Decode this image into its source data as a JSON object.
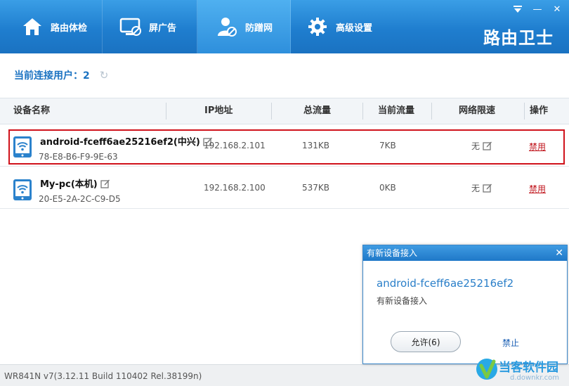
{
  "app": {
    "brand": "路由卫士",
    "status_bar": "WR841N v7(3.12.11 Build 110402 Rel.38199n)"
  },
  "nav": {
    "tabs": [
      {
        "label": "路由体检",
        "icon": "home-icon",
        "active": false
      },
      {
        "label": "屏广告",
        "icon": "monitor-block-icon",
        "active": false
      },
      {
        "label": "防蹭网",
        "icon": "user-shield-icon",
        "active": true
      },
      {
        "label": "高级设置",
        "icon": "gear-icon",
        "active": false
      }
    ]
  },
  "window_controls": {
    "menu_icon": "dropdown-icon",
    "minimize": "—",
    "close": "✕"
  },
  "users": {
    "label": "当前连接用户：2",
    "refresh_icon": "refresh-icon"
  },
  "table": {
    "headers": [
      "设备名称",
      "IP地址",
      "总流量",
      "当前流量",
      "网络限速",
      "操作"
    ],
    "rows": [
      {
        "name": "android-fceff6ae25216ef2(中兴)",
        "mac": "78-E8-B6-F9-9E-63",
        "ip": "192.168.2.101",
        "total": "131KB",
        "current": "7KB",
        "limit": "无",
        "action": "禁用",
        "highlighted": true
      },
      {
        "name": "My-pc(本机)",
        "mac": "20-E5-2A-2C-C9-D5",
        "ip": "192.168.2.100",
        "total": "537KB",
        "current": "0KB",
        "limit": "无",
        "action": "禁用",
        "highlighted": false
      }
    ]
  },
  "popup": {
    "title": "有新设备接入",
    "close": "✕",
    "device": "android-fceff6ae25216ef2",
    "subtitle": "有新设备接入",
    "allow": "允许(6)",
    "deny": "禁止"
  },
  "watermark": {
    "text": "当客软件园",
    "url": "d.downkr.com"
  },
  "colors": {
    "accent": "#1f7ecf",
    "highlight_border": "#d0121b",
    "link_red": "#c0151c",
    "popup_link": "#2a7fc9"
  }
}
